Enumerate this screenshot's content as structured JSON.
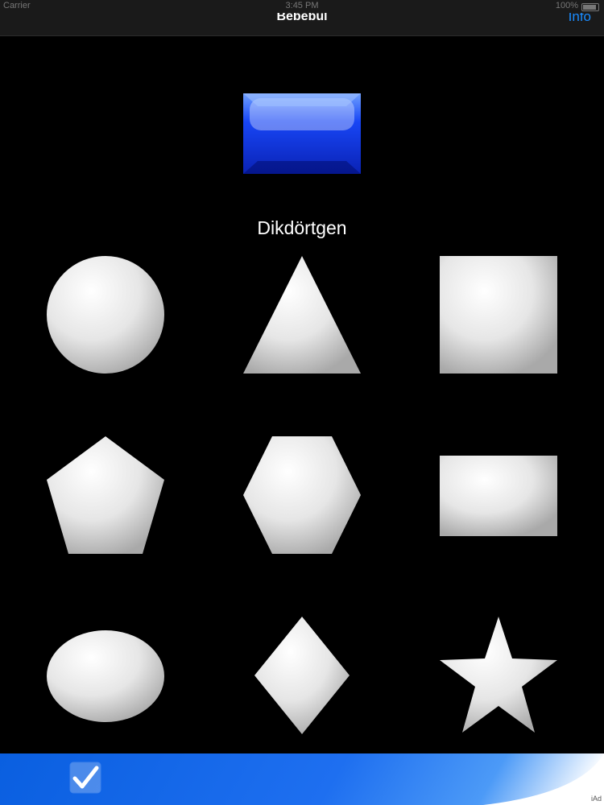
{
  "status_bar": {
    "carrier": "Carrier",
    "time": "3:45 PM",
    "battery": "100%"
  },
  "nav": {
    "title": "Bebebul",
    "info_label": "Info"
  },
  "target": {
    "name": "Dikdörtgen",
    "color": "#1a4cff"
  },
  "shapes": [
    "circle",
    "triangle",
    "square",
    "pentagon",
    "hexagon",
    "rectangle",
    "ellipse",
    "diamond",
    "star"
  ],
  "footer": {
    "ad_label": "iAd"
  },
  "icons": [
    "checkmark-icon",
    "battery-icon",
    "wifi-icon"
  ]
}
